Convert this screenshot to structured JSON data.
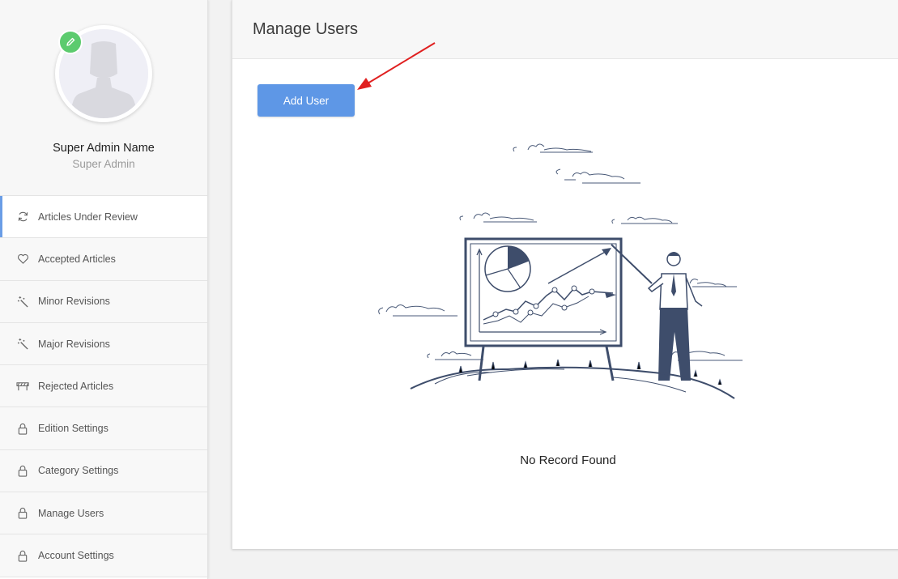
{
  "sidebar": {
    "profile": {
      "name": "Super Admin Name",
      "role": "Super Admin",
      "edit_icon": "pencil-icon",
      "avatar_icon": "user-silhouette"
    },
    "items": [
      {
        "label": "Articles Under Review",
        "icon": "refresh-icon",
        "active": true
      },
      {
        "label": "Accepted Articles",
        "icon": "heart-icon",
        "active": false
      },
      {
        "label": "Minor Revisions",
        "icon": "magic-wand-icon",
        "active": false
      },
      {
        "label": "Major Revisions",
        "icon": "magic-wand-icon",
        "active": false
      },
      {
        "label": "Rejected Articles",
        "icon": "barrier-icon",
        "active": false
      },
      {
        "label": "Edition Settings",
        "icon": "lock-icon",
        "active": false
      },
      {
        "label": "Category Settings",
        "icon": "lock-icon",
        "active": false
      },
      {
        "label": "Manage Users",
        "icon": "lock-icon",
        "active": false
      },
      {
        "label": "Account Settings",
        "icon": "lock-icon",
        "active": false
      }
    ]
  },
  "main": {
    "title": "Manage Users",
    "add_button_label": "Add User",
    "empty_message": "No Record Found"
  },
  "colors": {
    "accent": "#5e97e6",
    "edit_badge": "#5ccb6e",
    "annotation_arrow": "#e02020"
  }
}
